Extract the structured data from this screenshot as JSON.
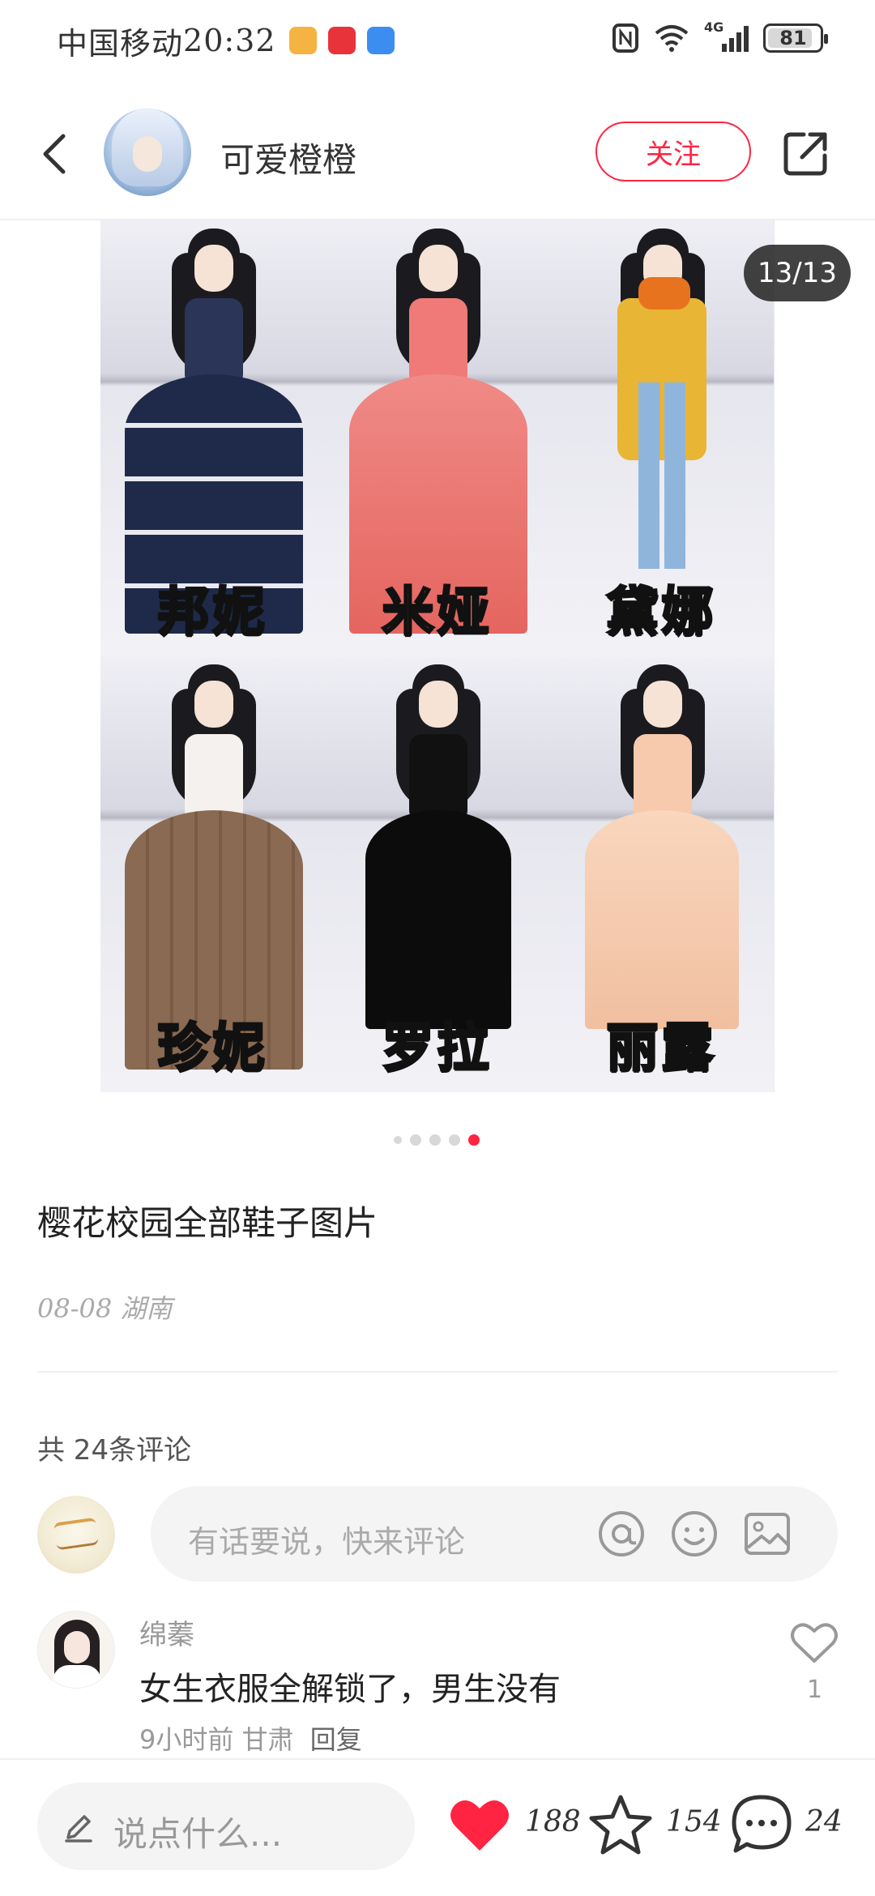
{
  "status_bar": {
    "carrier": "中国移动",
    "time": "20:32",
    "battery": "81",
    "network": "4G"
  },
  "header": {
    "username": "可爱橙橙",
    "follow_label": "关注"
  },
  "image": {
    "counter": "13/13",
    "labels": [
      "邦妮",
      "米娅",
      "黛娜",
      "珍妮",
      "罗拉",
      "丽露"
    ]
  },
  "post": {
    "title": "樱花校园全部鞋子图片",
    "meta": "08-08 湖南"
  },
  "comments": {
    "count_label": "共 24条评论",
    "input_placeholder": "有话要说，快来评论",
    "items": [
      {
        "name": "绵蓁",
        "text": "女生衣服全解锁了，男生没有",
        "time": "9小时前",
        "location": "甘肃",
        "reply_label": "回复",
        "likes": "1"
      }
    ]
  },
  "bottom_bar": {
    "input_placeholder": "说点什么...",
    "likes": "188",
    "favorites": "154",
    "comments": "24"
  },
  "colors": {
    "accent": "#ff2442",
    "label_yellow": "#ffe11a"
  }
}
